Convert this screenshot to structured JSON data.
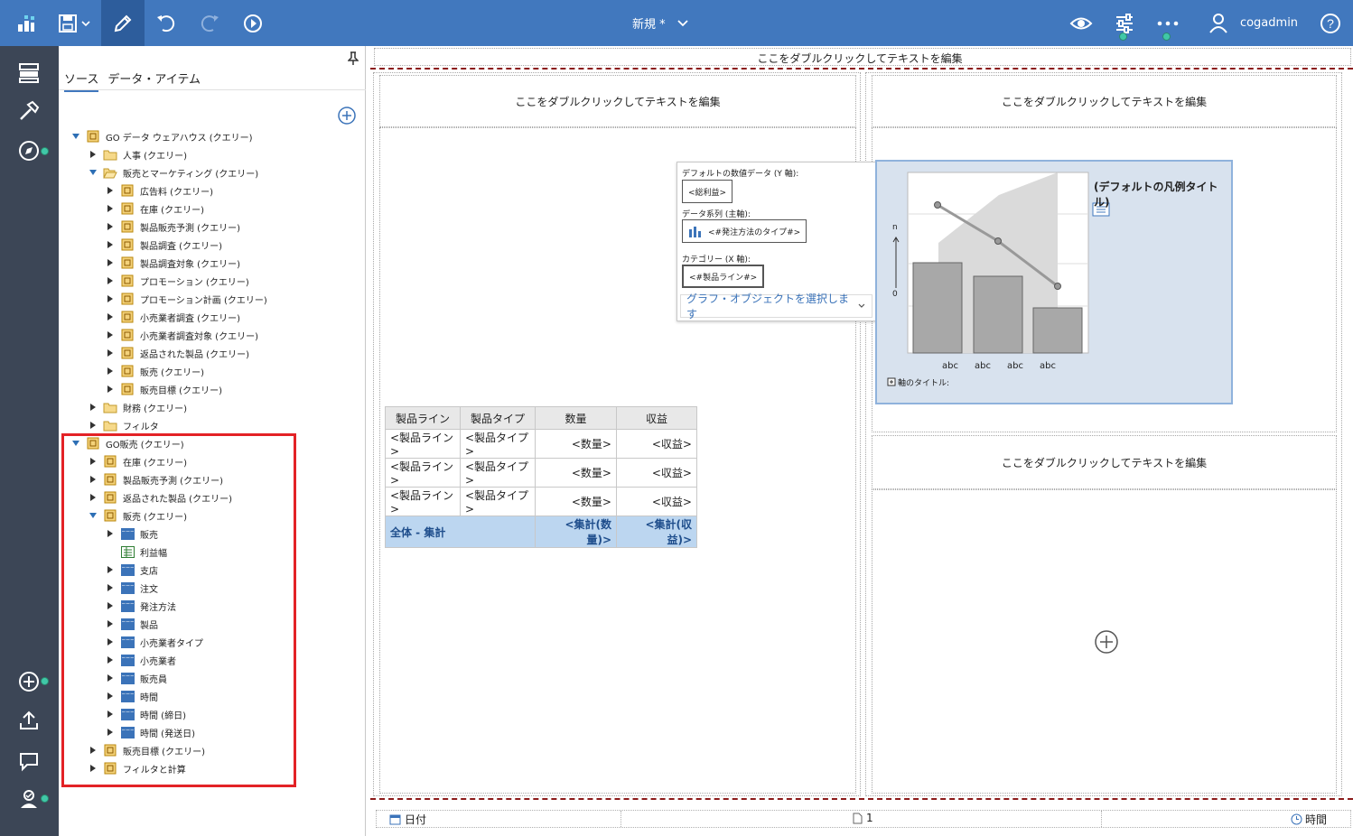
{
  "topbar": {
    "title": "新規 *",
    "user": "cogadmin"
  },
  "panel": {
    "tabs": [
      "ソース",
      "データ・アイテム"
    ]
  },
  "tree": [
    {
      "label": "GO データ ウェアハウス (クエリー)",
      "level": 0,
      "icon": "package-icon",
      "state": "expanded"
    },
    {
      "label": "人事 (クエリー)",
      "level": 1,
      "icon": "folder-icon",
      "state": "collapsed"
    },
    {
      "label": "販売とマーケティング (クエリー)",
      "level": 1,
      "icon": "folder-open-icon",
      "state": "expanded"
    },
    {
      "label": "広告料 (クエリー)",
      "level": 2,
      "icon": "package-icon",
      "state": "collapsed"
    },
    {
      "label": "在庫 (クエリー)",
      "level": 2,
      "icon": "package-icon",
      "state": "collapsed"
    },
    {
      "label": "製品販売予測 (クエリー)",
      "level": 2,
      "icon": "package-icon",
      "state": "collapsed"
    },
    {
      "label": "製品調査 (クエリー)",
      "level": 2,
      "icon": "package-icon",
      "state": "collapsed"
    },
    {
      "label": "製品調査対象 (クエリー)",
      "level": 2,
      "icon": "package-icon",
      "state": "collapsed"
    },
    {
      "label": "プロモーション (クエリー)",
      "level": 2,
      "icon": "package-icon",
      "state": "collapsed"
    },
    {
      "label": "プロモーション計画 (クエリー)",
      "level": 2,
      "icon": "package-icon",
      "state": "collapsed"
    },
    {
      "label": "小売業者調査 (クエリー)",
      "level": 2,
      "icon": "package-icon",
      "state": "collapsed"
    },
    {
      "label": "小売業者調査対象 (クエリー)",
      "level": 2,
      "icon": "package-icon",
      "state": "collapsed"
    },
    {
      "label": "返品された製品 (クエリー)",
      "level": 2,
      "icon": "package-icon",
      "state": "collapsed"
    },
    {
      "label": "販売 (クエリー)",
      "level": 2,
      "icon": "package-icon",
      "state": "collapsed"
    },
    {
      "label": "販売目標 (クエリー)",
      "level": 2,
      "icon": "package-icon",
      "state": "collapsed"
    },
    {
      "label": "財務 (クエリー)",
      "level": 1,
      "icon": "folder-icon",
      "state": "collapsed"
    },
    {
      "label": "フィルタ",
      "level": 1,
      "icon": "folder-icon",
      "state": "collapsed"
    },
    {
      "label": "GO販売 (クエリー)",
      "level": 0,
      "icon": "package-icon",
      "state": "expanded"
    },
    {
      "label": "在庫 (クエリー)",
      "level": 1,
      "icon": "package-icon",
      "state": "collapsed"
    },
    {
      "label": "製品販売予測 (クエリー)",
      "level": 1,
      "icon": "package-icon",
      "state": "collapsed"
    },
    {
      "label": "返品された製品 (クエリー)",
      "level": 1,
      "icon": "package-icon",
      "state": "collapsed"
    },
    {
      "label": "販売 (クエリー)",
      "level": 1,
      "icon": "package-icon",
      "state": "expanded"
    },
    {
      "label": "販売",
      "level": 2,
      "icon": "table-icon",
      "state": "collapsed"
    },
    {
      "label": "利益幅",
      "level": 2,
      "icon": "calc-icon",
      "state": "none"
    },
    {
      "label": "支店",
      "level": 2,
      "icon": "table-icon",
      "state": "collapsed"
    },
    {
      "label": "注文",
      "level": 2,
      "icon": "table-icon",
      "state": "collapsed"
    },
    {
      "label": "発注方法",
      "level": 2,
      "icon": "table-icon",
      "state": "collapsed"
    },
    {
      "label": "製品",
      "level": 2,
      "icon": "table-icon",
      "state": "collapsed"
    },
    {
      "label": "小売業者タイプ",
      "level": 2,
      "icon": "table-icon",
      "state": "collapsed"
    },
    {
      "label": "小売業者",
      "level": 2,
      "icon": "table-icon",
      "state": "collapsed"
    },
    {
      "label": "販売員",
      "level": 2,
      "icon": "table-icon",
      "state": "collapsed"
    },
    {
      "label": "時間",
      "level": 2,
      "icon": "table-icon",
      "state": "collapsed"
    },
    {
      "label": "時間 (締日)",
      "level": 2,
      "icon": "table-icon",
      "state": "collapsed"
    },
    {
      "label": "時間 (発送日)",
      "level": 2,
      "icon": "table-icon",
      "state": "collapsed"
    },
    {
      "label": "販売目標 (クエリー)",
      "level": 1,
      "icon": "package-icon",
      "state": "collapsed"
    },
    {
      "label": "フィルタと計算",
      "level": 1,
      "icon": "package-icon",
      "state": "collapsed"
    }
  ],
  "report": {
    "page_header": "ここをダブルクリックしてテキストを編集",
    "left_header": "ここをダブルクリックしてテキストを編集",
    "right_header": "ここをダブルクリックしてテキストを編集",
    "right_lower_header": "ここをダブルクリックしてテキストを編集",
    "table": {
      "headers": [
        "製品ライン",
        "製品タイプ",
        "数量",
        "収益"
      ],
      "rows": [
        [
          "<製品ライン>",
          "<製品タイプ>",
          "<数量>",
          "<収益>"
        ],
        [
          "<製品ライン>",
          "<製品タイプ>",
          "<数量>",
          "<収益>"
        ],
        [
          "<製品ライン>",
          "<製品タイプ>",
          "<数量>",
          "<収益>"
        ]
      ],
      "total": [
        "全体 - 集計",
        "<集計(数量)>",
        "<集計(収益)>"
      ]
    },
    "dropzone": {
      "y_label": "デフォルトの数値データ (Y 軸):",
      "y_value": "<総利益>",
      "series_label": "データ系列 (主軸):",
      "series_value": "<#発注方法のタイプ#>",
      "x_label": "カテゴリー (X 軸):",
      "x_value": "<#製品ライン#>",
      "select": "グラフ・オブジェクトを選択します"
    },
    "chart": {
      "legend_title": "(デフォルトの凡例タイトル)",
      "y_tick_top": "n",
      "y_tick_bottom": "0",
      "x_ticks": [
        "abc",
        "abc",
        "abc",
        "abc"
      ],
      "axis_title": "軸のタイトル:"
    },
    "footer": {
      "date": "日付",
      "page": "1",
      "time": "時間"
    }
  }
}
